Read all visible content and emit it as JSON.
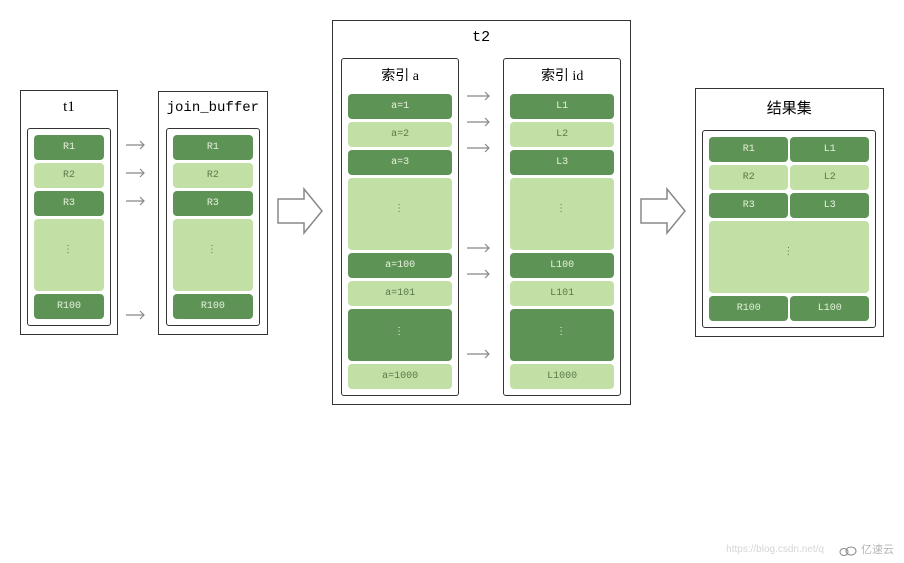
{
  "t1": {
    "title": "t1",
    "rows": [
      "R1",
      "R2",
      "R3"
    ],
    "last": "R100"
  },
  "join_buffer": {
    "title": "join_buffer",
    "rows": [
      "R1",
      "R2",
      "R3"
    ],
    "last": "R100"
  },
  "t2": {
    "title": "t2",
    "index_a": {
      "title": "索引 a",
      "rows": [
        "a=1",
        "a=2",
        "a=3"
      ],
      "mid": [
        "a=100",
        "a=101"
      ],
      "last": "a=1000"
    },
    "index_id": {
      "title": "索引 id",
      "rows": [
        "L1",
        "L2",
        "L3"
      ],
      "mid": [
        "L100",
        "L101"
      ],
      "last": "L1000"
    }
  },
  "result": {
    "title": "结果集",
    "rows": [
      {
        "l": "R1",
        "r": "L1"
      },
      {
        "l": "R2",
        "r": "L2"
      },
      {
        "l": "R3",
        "r": "L3"
      }
    ],
    "last": {
      "l": "R100",
      "r": "L100"
    }
  },
  "colors": {
    "dark": "#5d9456",
    "light": "#c2e0a6"
  },
  "watermark": "亿速云",
  "url": "https://blog.csdn.net/q"
}
